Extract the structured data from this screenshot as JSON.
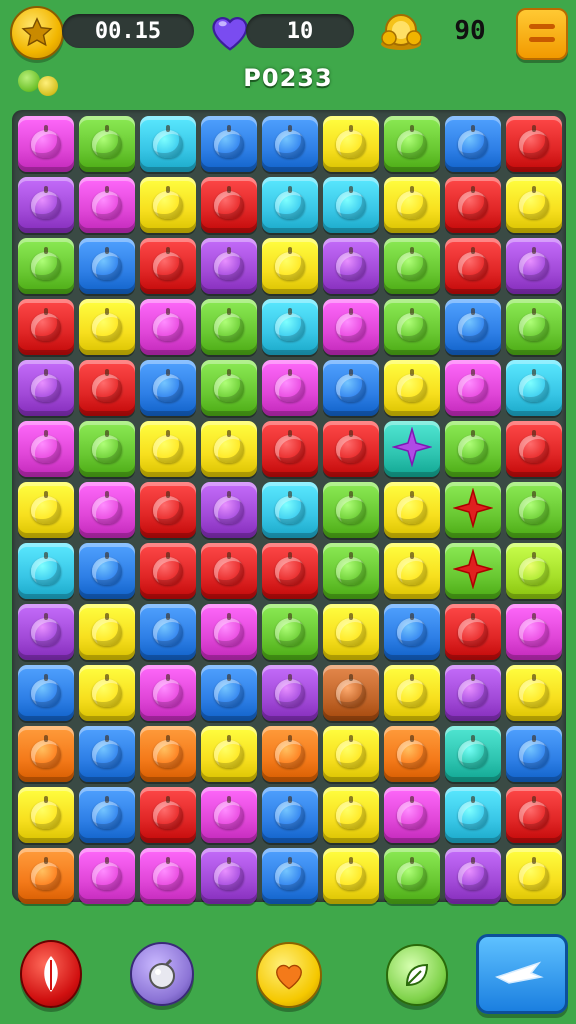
{
  "hud": {
    "timer": "00.15",
    "lives": "10",
    "coins": "90",
    "level": "P0233"
  },
  "icons": {
    "timer_icon": "star-coin-icon",
    "lives_icon": "heart-icon",
    "coins_icon": "coin-pile-icon",
    "menu_icon": "menu-icon"
  },
  "palette": {
    "red": "#e02626",
    "orange": "#f47a1a",
    "yellow": "#f7df1e",
    "green": "#69c832",
    "lime": "#a6e02a",
    "cyan": "#38c6e6",
    "blue": "#2e7fe6",
    "purple": "#a24ad8",
    "magenta": "#e046d8",
    "teal": "#2ec4b0",
    "brown": "#c2662a"
  },
  "board": {
    "rows": 13,
    "cols": 9,
    "grid": [
      [
        "magenta",
        "green",
        "cyan",
        "blue",
        "blue",
        "yellow",
        "green",
        "blue",
        "red"
      ],
      [
        "purple",
        "magenta",
        "yellow",
        "red",
        "cyan",
        "cyan",
        "yellow",
        "red",
        "yellow"
      ],
      [
        "green",
        "blue",
        "red",
        "purple",
        "yellow",
        "purple",
        "green",
        "red",
        "purple"
      ],
      [
        "red",
        "yellow",
        "magenta",
        "green",
        "cyan",
        "magenta",
        "green",
        "blue",
        "green"
      ],
      [
        "purple",
        "red",
        "blue",
        "green",
        "magenta",
        "blue",
        "yellow",
        "magenta",
        "cyan"
      ],
      [
        "magenta",
        "green",
        "yellow",
        "yellow",
        "red",
        "red",
        "teal",
        "green",
        "red"
      ],
      [
        "yellow",
        "magenta",
        "red",
        "purple",
        "cyan",
        "green",
        "yellow",
        "green",
        "green"
      ],
      [
        "cyan",
        "blue",
        "red",
        "red",
        "red",
        "green",
        "yellow",
        "green",
        "lime"
      ],
      [
        "purple",
        "yellow",
        "blue",
        "magenta",
        "green",
        "yellow",
        "blue",
        "red",
        "magenta"
      ],
      [
        "blue",
        "yellow",
        "magenta",
        "blue",
        "purple",
        "brown",
        "yellow",
        "purple",
        "yellow"
      ],
      [
        "orange",
        "blue",
        "orange",
        "yellow",
        "orange",
        "yellow",
        "orange",
        "teal",
        "blue"
      ],
      [
        "yellow",
        "blue",
        "red",
        "magenta",
        "blue",
        "yellow",
        "magenta",
        "cyan",
        "red"
      ],
      [
        "orange",
        "magenta",
        "magenta",
        "purple",
        "blue",
        "yellow",
        "green",
        "purple",
        "yellow"
      ]
    ],
    "specials": [
      {
        "row": 5,
        "col": 6,
        "kind": "purple-star-icon"
      },
      {
        "row": 6,
        "col": 7,
        "kind": "red-star-icon"
      },
      {
        "row": 7,
        "col": 7,
        "kind": "red-star-icon"
      }
    ]
  },
  "buttons": [
    {
      "name": "shuffle-booster",
      "icon": "feather-icon",
      "color": "#e01f1f"
    },
    {
      "name": "bomb-booster",
      "icon": "bomb-icon",
      "color": "#8f7ad8"
    },
    {
      "name": "heart-booster",
      "icon": "heart-icon",
      "color": "#ffd21a"
    },
    {
      "name": "hammer-booster",
      "icon": "leaf-icon",
      "color": "#7fd24a"
    },
    {
      "name": "play-button",
      "icon": "plane-icon",
      "color": "#2d8fe8"
    }
  ]
}
